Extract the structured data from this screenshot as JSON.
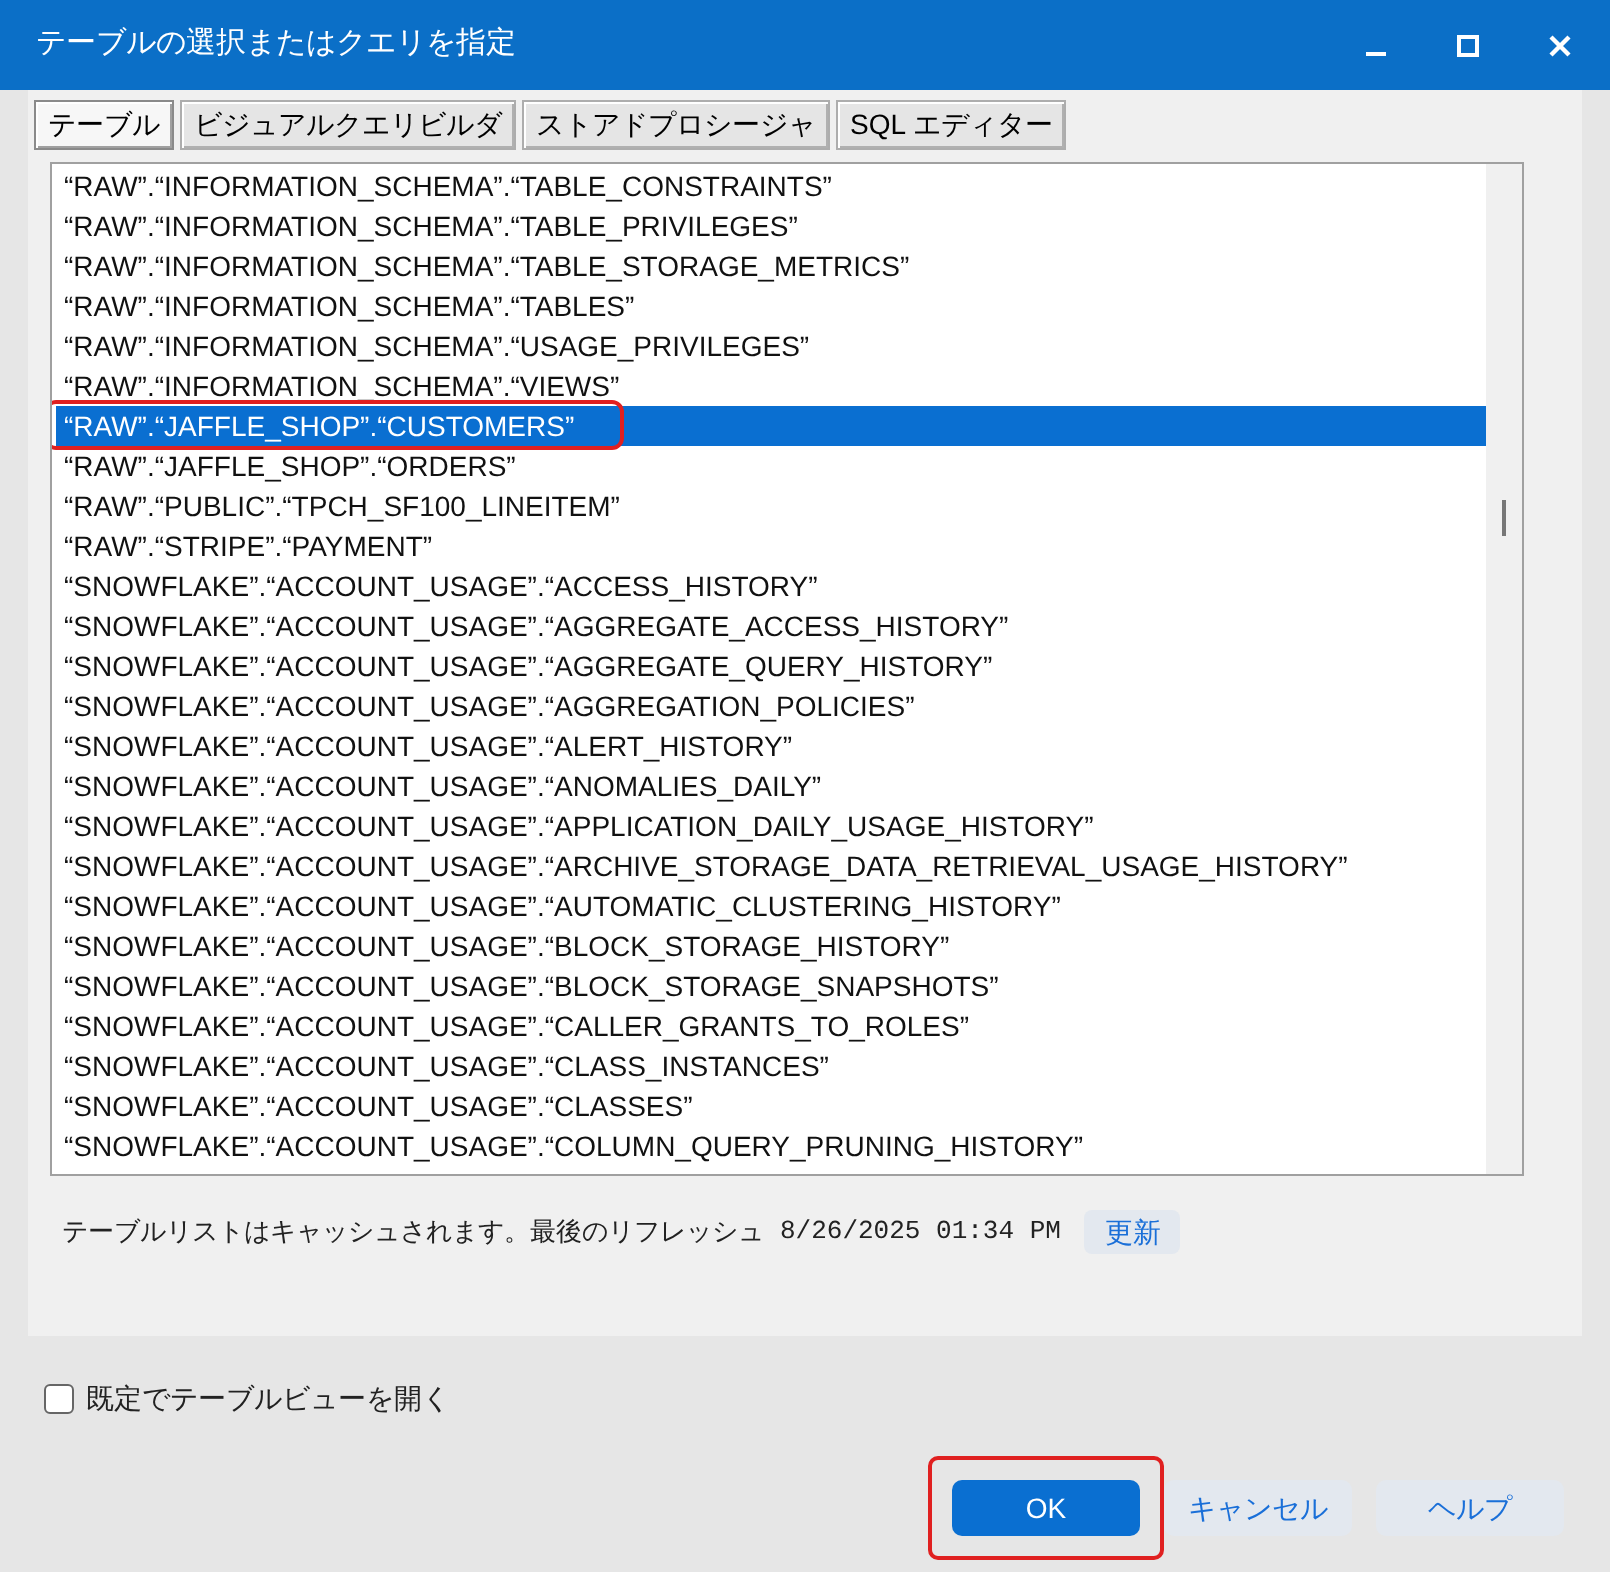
{
  "window": {
    "title": "テーブルの選択またはクエリを指定"
  },
  "tabs": [
    {
      "label": "テーブル",
      "selected": true
    },
    {
      "label": "ビジュアルクエリビルダ",
      "selected": false
    },
    {
      "label": "ストアドプロシージャ",
      "selected": false
    },
    {
      "label": "SQL エディター",
      "selected": false
    }
  ],
  "table_list": {
    "items": [
      {
        "label": "“RAW”.“INFORMATION_SCHEMA”.“TABLE_CONSTRAINTS”",
        "selected": false,
        "highlighted": false
      },
      {
        "label": "“RAW”.“INFORMATION_SCHEMA”.“TABLE_PRIVILEGES”",
        "selected": false,
        "highlighted": false
      },
      {
        "label": "“RAW”.“INFORMATION_SCHEMA”.“TABLE_STORAGE_METRICS”",
        "selected": false,
        "highlighted": false
      },
      {
        "label": "“RAW”.“INFORMATION_SCHEMA”.“TABLES”",
        "selected": false,
        "highlighted": false
      },
      {
        "label": "“RAW”.“INFORMATION_SCHEMA”.“USAGE_PRIVILEGES”",
        "selected": false,
        "highlighted": false
      },
      {
        "label": "“RAW”.“INFORMATION_SCHEMA”.“VIEWS”",
        "selected": false,
        "highlighted": false
      },
      {
        "label": "“RAW”.“JAFFLE_SHOP”.“CUSTOMERS”",
        "selected": true,
        "highlighted": true
      },
      {
        "label": "“RAW”.“JAFFLE_SHOP”.“ORDERS”",
        "selected": false,
        "highlighted": false
      },
      {
        "label": "“RAW”.“PUBLIC”.“TPCH_SF100_LINEITEM”",
        "selected": false,
        "highlighted": false
      },
      {
        "label": "“RAW”.“STRIPE”.“PAYMENT”",
        "selected": false,
        "highlighted": false
      },
      {
        "label": "“SNOWFLAKE”.“ACCOUNT_USAGE”.“ACCESS_HISTORY”",
        "selected": false,
        "highlighted": false
      },
      {
        "label": "“SNOWFLAKE”.“ACCOUNT_USAGE”.“AGGREGATE_ACCESS_HISTORY”",
        "selected": false,
        "highlighted": false
      },
      {
        "label": "“SNOWFLAKE”.“ACCOUNT_USAGE”.“AGGREGATE_QUERY_HISTORY”",
        "selected": false,
        "highlighted": false
      },
      {
        "label": "“SNOWFLAKE”.“ACCOUNT_USAGE”.“AGGREGATION_POLICIES”",
        "selected": false,
        "highlighted": false
      },
      {
        "label": "“SNOWFLAKE”.“ACCOUNT_USAGE”.“ALERT_HISTORY”",
        "selected": false,
        "highlighted": false
      },
      {
        "label": "“SNOWFLAKE”.“ACCOUNT_USAGE”.“ANOMALIES_DAILY”",
        "selected": false,
        "highlighted": false
      },
      {
        "label": "“SNOWFLAKE”.“ACCOUNT_USAGE”.“APPLICATION_DAILY_USAGE_HISTORY”",
        "selected": false,
        "highlighted": false
      },
      {
        "label": "“SNOWFLAKE”.“ACCOUNT_USAGE”.“ARCHIVE_STORAGE_DATA_RETRIEVAL_USAGE_HISTORY”",
        "selected": false,
        "highlighted": false
      },
      {
        "label": "“SNOWFLAKE”.“ACCOUNT_USAGE”.“AUTOMATIC_CLUSTERING_HISTORY”",
        "selected": false,
        "highlighted": false
      },
      {
        "label": "“SNOWFLAKE”.“ACCOUNT_USAGE”.“BLOCK_STORAGE_HISTORY”",
        "selected": false,
        "highlighted": false
      },
      {
        "label": "“SNOWFLAKE”.“ACCOUNT_USAGE”.“BLOCK_STORAGE_SNAPSHOTS”",
        "selected": false,
        "highlighted": false
      },
      {
        "label": "“SNOWFLAKE”.“ACCOUNT_USAGE”.“CALLER_GRANTS_TO_ROLES”",
        "selected": false,
        "highlighted": false
      },
      {
        "label": "“SNOWFLAKE”.“ACCOUNT_USAGE”.“CLASS_INSTANCES”",
        "selected": false,
        "highlighted": false
      },
      {
        "label": "“SNOWFLAKE”.“ACCOUNT_USAGE”.“CLASSES”",
        "selected": false,
        "highlighted": false
      },
      {
        "label": "“SNOWFLAKE”.“ACCOUNT_USAGE”.“COLUMN_QUERY_PRUNING_HISTORY”",
        "selected": false,
        "highlighted": false
      }
    ]
  },
  "cache_note": {
    "text": "テーブルリストはキャッシュされます。最後のリフレッシュ",
    "timestamp": "8/26/2025 01:34 PM",
    "refresh_button": "更新"
  },
  "open_table_view": {
    "label": "既定でテーブルビューを開く",
    "checked": false
  },
  "buttons": [
    {
      "label": "OK",
      "kind": "primary",
      "highlighted": true
    },
    {
      "label": "キャンセル",
      "kind": "secondary",
      "highlighted": false
    },
    {
      "label": "ヘルプ",
      "kind": "secondary",
      "highlighted": false
    }
  ]
}
